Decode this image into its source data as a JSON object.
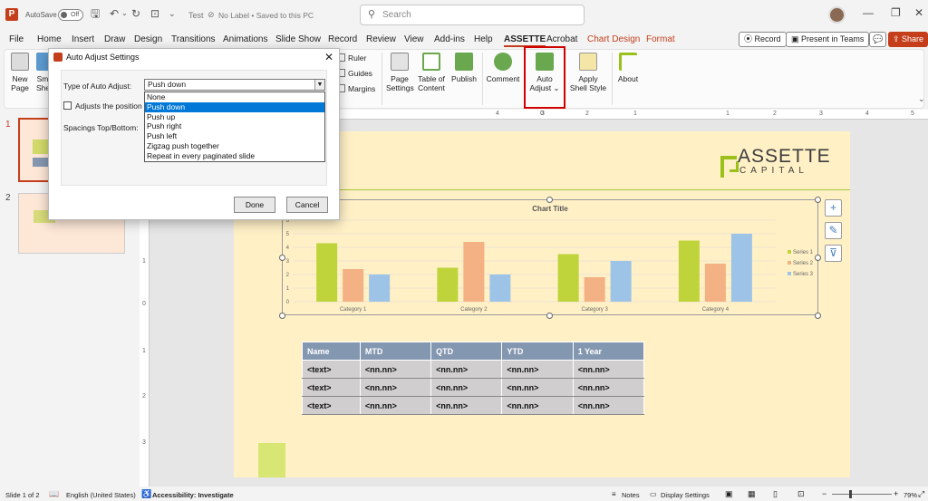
{
  "titlebar": {
    "autosave_label": "AutoSave",
    "autosave_state": "Off",
    "doc_title": "Test",
    "label_status": "No Label • Saved to this PC",
    "search_placeholder": "Search"
  },
  "menu": {
    "tabs": [
      "File",
      "Home",
      "Insert",
      "Draw",
      "Design",
      "Transitions",
      "Animations",
      "Slide Show",
      "Record",
      "Review",
      "View",
      "Add-ins",
      "Help",
      "ASSETTE",
      "Acrobat"
    ],
    "context_tabs": [
      "Chart Design",
      "Format"
    ],
    "active_tab": "ASSETTE",
    "record_label": "Record",
    "present_label": "Present in Teams",
    "share_label": "Share"
  },
  "ribbon": {
    "new_page": "New Page",
    "sm_partial": "Sm She",
    "ruler": "Ruler",
    "guides": "Guides",
    "margins": "Margins",
    "page_settings": "Page Settings",
    "toc": "Table of Content",
    "publish": "Publish",
    "comment": "Comment",
    "auto_adjust": "Auto Adjust",
    "apply_shell": "Apply Shell Style",
    "about": "About"
  },
  "dialog": {
    "title": "Auto Adjust Settings",
    "type_label": "Type of Auto Adjust:",
    "type_value": "Push down",
    "options": [
      "None",
      "Push down",
      "Push up",
      "Push right",
      "Push left",
      "Zigzag push together",
      "Repeat in every paginated slide"
    ],
    "selected_option": "Push down",
    "adjust_pos_label": "Adjusts the position w",
    "spacings_label": "Spacings Top/Bottom:",
    "done": "Done",
    "cancel": "Cancel"
  },
  "slides": {
    "count_labels": [
      "1",
      "2"
    ]
  },
  "slide": {
    "logo_line1": "ASSETTE",
    "logo_line2": "CAPITAL"
  },
  "chart_data": {
    "type": "bar",
    "title": "Chart Title",
    "categories": [
      "Category 1",
      "Category 2",
      "Category 3",
      "Category 4"
    ],
    "series": [
      {
        "name": "Series 1",
        "values": [
          4.3,
          2.5,
          3.5,
          4.5
        ],
        "color": "#bed43a"
      },
      {
        "name": "Series 2",
        "values": [
          2.4,
          4.4,
          1.8,
          2.8
        ],
        "color": "#f4b183"
      },
      {
        "name": "Series 3",
        "values": [
          2,
          2,
          3,
          5
        ],
        "color": "#9dc3e6"
      }
    ],
    "ylim": [
      0,
      6
    ],
    "yticks": [
      "0",
      "1",
      "2",
      "3",
      "4",
      "5",
      "6"
    ],
    "legend": "right",
    "grid": true
  },
  "table": {
    "headers": [
      "Name",
      "MTD",
      "QTD",
      "YTD",
      "1 Year"
    ],
    "rows": [
      [
        "<text>",
        "<nn.nn>",
        "<nn.nn>",
        "<nn.nn>",
        "<nn.nn>"
      ],
      [
        "<text>",
        "<nn.nn>",
        "<nn.nn>",
        "<nn.nn>",
        "<nn.nn>"
      ],
      [
        "<text>",
        "<nn.nn>",
        "<nn.nn>",
        "<nn.nn>",
        "<nn.nn>"
      ]
    ]
  },
  "ruler": {
    "h_ticks": [
      "6",
      "5",
      "4",
      "3",
      "2",
      "1",
      "0",
      "1",
      "2",
      "3",
      "4",
      "5",
      "6"
    ],
    "v_ticks": [
      "1",
      "0",
      "1",
      "2",
      "3"
    ]
  },
  "statusbar": {
    "slide_info": "Slide 1 of 2",
    "language": "English (United States)",
    "accessibility": "Accessibility: Investigate",
    "notes": "Notes",
    "display": "Display Settings",
    "zoom": "79%"
  },
  "colors": {
    "accent": "#c43e1c",
    "highlight": "#d00000",
    "brand_green": "#9ac11a",
    "table_header": "#8497b0"
  }
}
